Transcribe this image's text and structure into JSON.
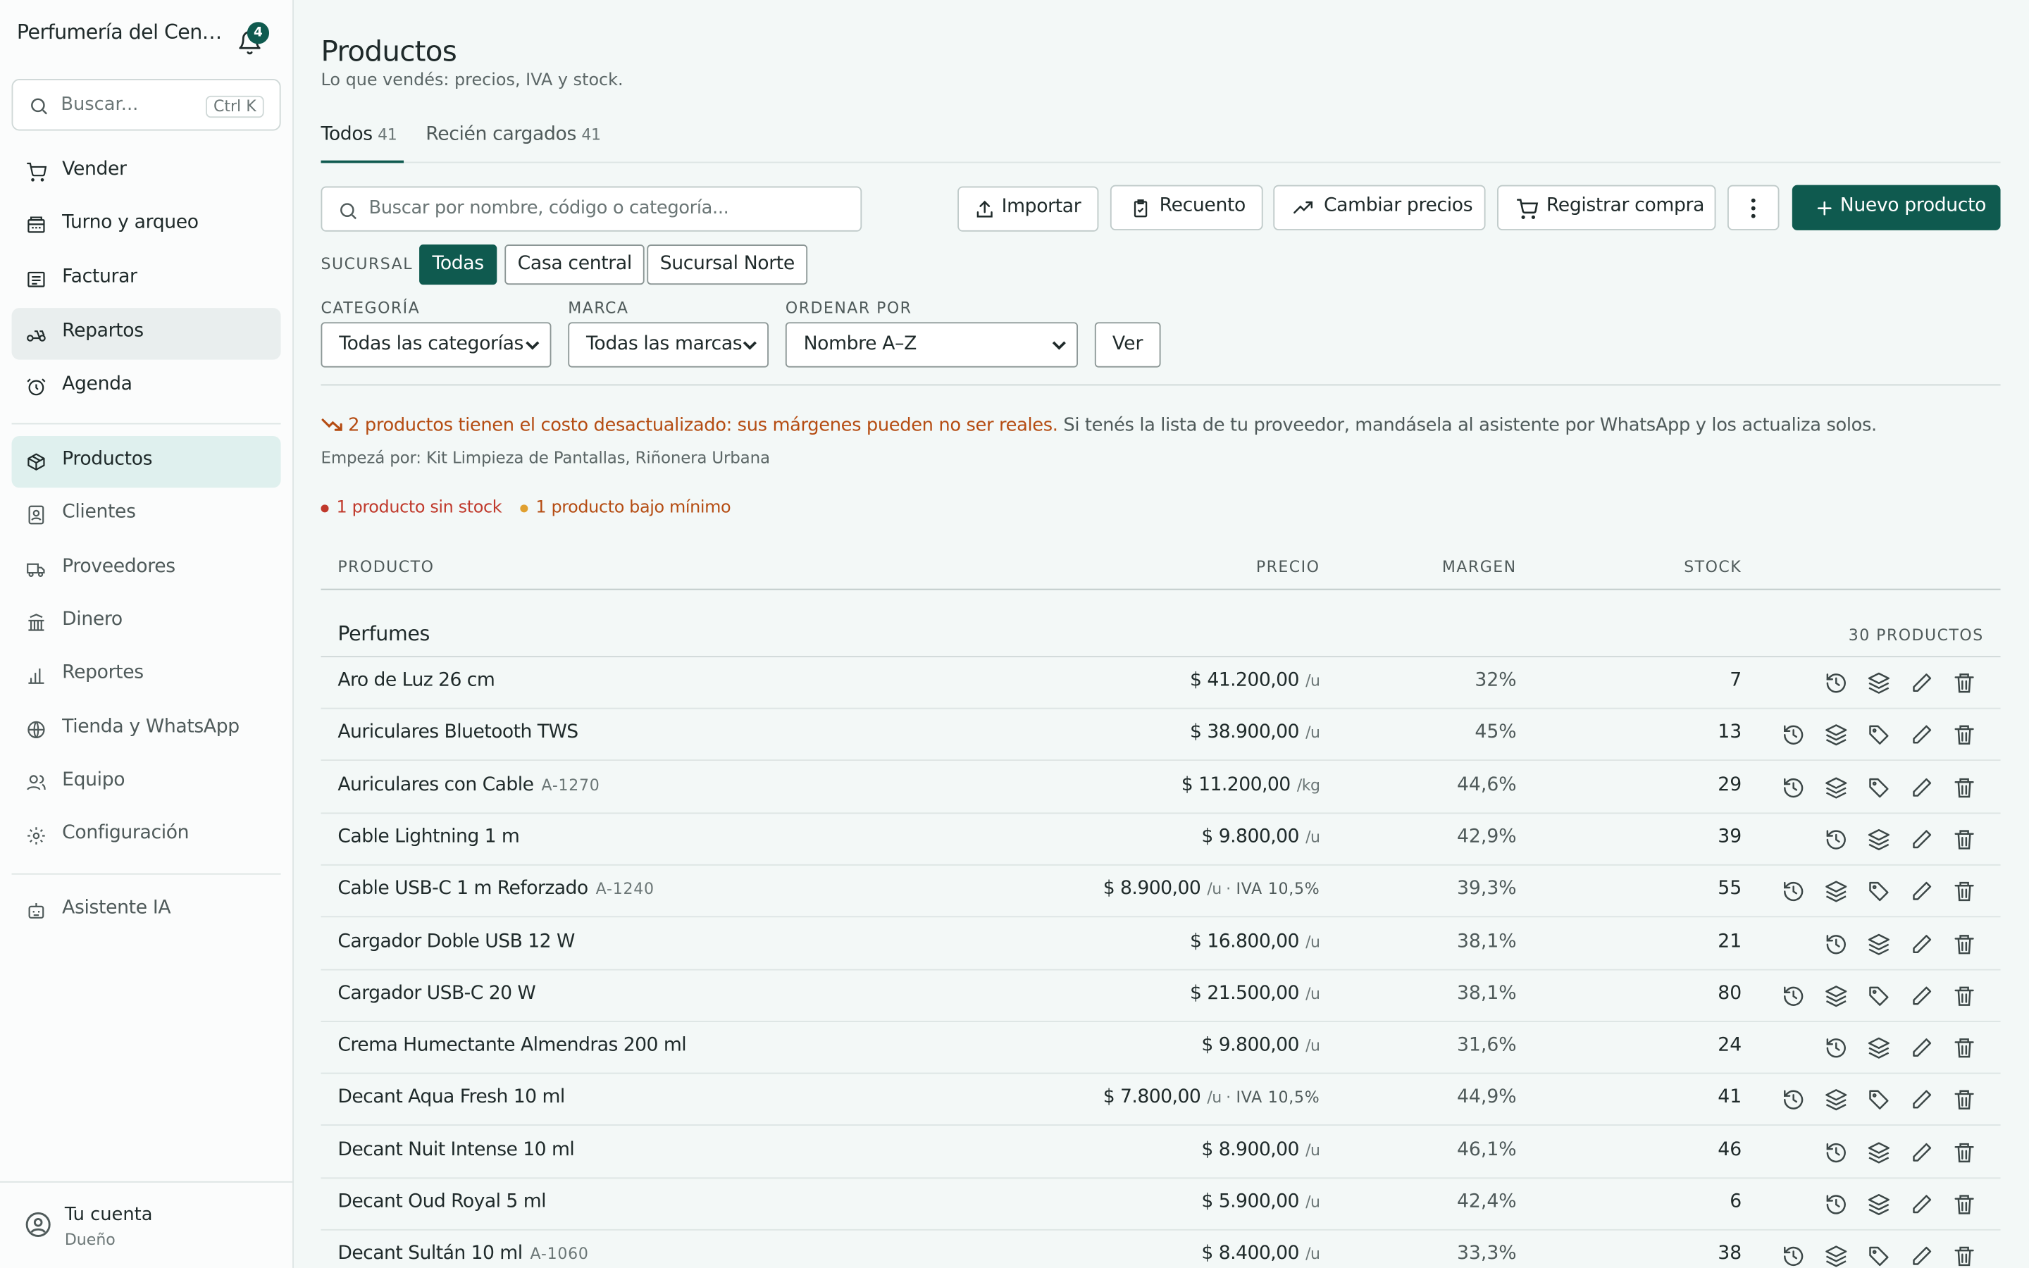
{
  "sidebar": {
    "brand": "Perfumería del Centro",
    "notifications": "4",
    "search": {
      "placeholder": "Buscar...",
      "shortcut": "Ctrl K"
    },
    "items": [
      {
        "label": "Vender",
        "icon": "cart-icon"
      },
      {
        "label": "Turno y arqueo",
        "icon": "cash-register-icon"
      },
      {
        "label": "Facturar",
        "icon": "receipt-icon"
      },
      {
        "label": "Repartos",
        "icon": "scooter-icon"
      },
      {
        "label": "Agenda",
        "icon": "alarm-clock-icon"
      },
      {
        "label": "Productos",
        "icon": "box-icon"
      },
      {
        "label": "Clientes",
        "icon": "contact-icon"
      },
      {
        "label": "Proveedores",
        "icon": "truck-icon"
      },
      {
        "label": "Dinero",
        "icon": "bank-icon"
      },
      {
        "label": "Reportes",
        "icon": "bar-chart-icon"
      },
      {
        "label": "Tienda y WhatsApp",
        "icon": "globe-icon"
      },
      {
        "label": "Equipo",
        "icon": "users-icon"
      },
      {
        "label": "Configuración",
        "icon": "gear-icon"
      },
      {
        "label": "Asistente IA",
        "icon": "bot-icon"
      }
    ],
    "account": {
      "name": "Tu cuenta",
      "role": "Dueño"
    }
  },
  "page": {
    "title": "Productos",
    "subtitle": "Lo que vendés: precios, IVA y stock.",
    "tabs": [
      {
        "label": "Todos",
        "count": "41"
      },
      {
        "label": "Recién cargados",
        "count": "41"
      }
    ]
  },
  "toolbar": {
    "search_placeholder": "Buscar por nombre, código o categoría...",
    "import": "Importar",
    "count": "Recuento",
    "change_prices": "Cambiar precios",
    "register_purchase": "Registrar compra",
    "new_product": "Nuevo producto"
  },
  "filters": {
    "branch_label": "SUCURSAL",
    "branches": [
      "Todas",
      "Casa central",
      "Sucursal Norte"
    ],
    "category_label": "CATEGORÍA",
    "category_value": "Todas las categorías",
    "brand_label": "MARCA",
    "brand_value": "Todas las marcas",
    "sort_label": "ORDENAR POR",
    "sort_value": "Nombre A–Z",
    "apply": "Ver"
  },
  "alert": {
    "warning": "2 productos tienen el costo desactualizado: sus márgenes pueden no ser reales.",
    "rest": "Si tenés la lista de tu proveedor, mandásela al asistente por WhatsApp y los actualiza solos.",
    "start_with": "Empezá por: Kit Limpieza de Pantallas, Riñonera Urbana",
    "out_of_stock": "1 producto sin stock",
    "below_min": "1 producto bajo mínimo"
  },
  "colors": {
    "accent": "#0f5a4f",
    "warning": "#b54c12",
    "danger": "#c0392b",
    "caution": "#e0a030"
  },
  "table": {
    "headers": {
      "product": "PRODUCTO",
      "price": "PRECIO",
      "margin": "MARGEN",
      "stock": "STOCK"
    },
    "group": {
      "name": "Perfumes",
      "count": "30 PRODUCTOS"
    },
    "rows": [
      {
        "name": "Aro de Luz 26 cm",
        "sku": "",
        "price": "$ 41.200,00",
        "unit": "/u",
        "iva": "",
        "margin": "32%",
        "stock": "7",
        "tag": false
      },
      {
        "name": "Auriculares Bluetooth TWS",
        "sku": "",
        "price": "$ 38.900,00",
        "unit": "/u",
        "iva": "",
        "margin": "45%",
        "stock": "13",
        "tag": true
      },
      {
        "name": "Auriculares con Cable",
        "sku": "A-1270",
        "price": "$ 11.200,00",
        "unit": "/kg",
        "iva": "",
        "margin": "44,6%",
        "stock": "29",
        "tag": true
      },
      {
        "name": "Cable Lightning 1 m",
        "sku": "",
        "price": "$ 9.800,00",
        "unit": "/u",
        "iva": "",
        "margin": "42,9%",
        "stock": "39",
        "tag": false
      },
      {
        "name": "Cable USB-C 1 m Reforzado",
        "sku": "A-1240",
        "price": "$ 8.900,00",
        "unit": "/u ·",
        "iva": "IVA 10,5%",
        "margin": "39,3%",
        "stock": "55",
        "tag": true
      },
      {
        "name": "Cargador Doble USB 12 W",
        "sku": "",
        "price": "$ 16.800,00",
        "unit": "/u",
        "iva": "",
        "margin": "38,1%",
        "stock": "21",
        "tag": false
      },
      {
        "name": "Cargador USB-C 20 W",
        "sku": "",
        "price": "$ 21.500,00",
        "unit": "/u",
        "iva": "",
        "margin": "38,1%",
        "stock": "80",
        "tag": true
      },
      {
        "name": "Crema Humectante Almendras 200 ml",
        "sku": "",
        "price": "$ 9.800,00",
        "unit": "/u",
        "iva": "",
        "margin": "31,6%",
        "stock": "24",
        "tag": false
      },
      {
        "name": "Decant Aqua Fresh 10 ml",
        "sku": "",
        "price": "$ 7.800,00",
        "unit": "/u ·",
        "iva": "IVA 10,5%",
        "margin": "44,9%",
        "stock": "41",
        "tag": true
      },
      {
        "name": "Decant Nuit Intense 10 ml",
        "sku": "",
        "price": "$ 8.900,00",
        "unit": "/u",
        "iva": "",
        "margin": "46,1%",
        "stock": "46",
        "tag": false
      },
      {
        "name": "Decant Oud Royal 5 ml",
        "sku": "",
        "price": "$ 5.900,00",
        "unit": "/u",
        "iva": "",
        "margin": "42,4%",
        "stock": "6",
        "tag": false
      },
      {
        "name": "Decant Sultán 10 ml",
        "sku": "A-1060",
        "price": "$ 8.400,00",
        "unit": "/u",
        "iva": "",
        "margin": "33,3%",
        "stock": "38",
        "tag": true
      }
    ]
  }
}
